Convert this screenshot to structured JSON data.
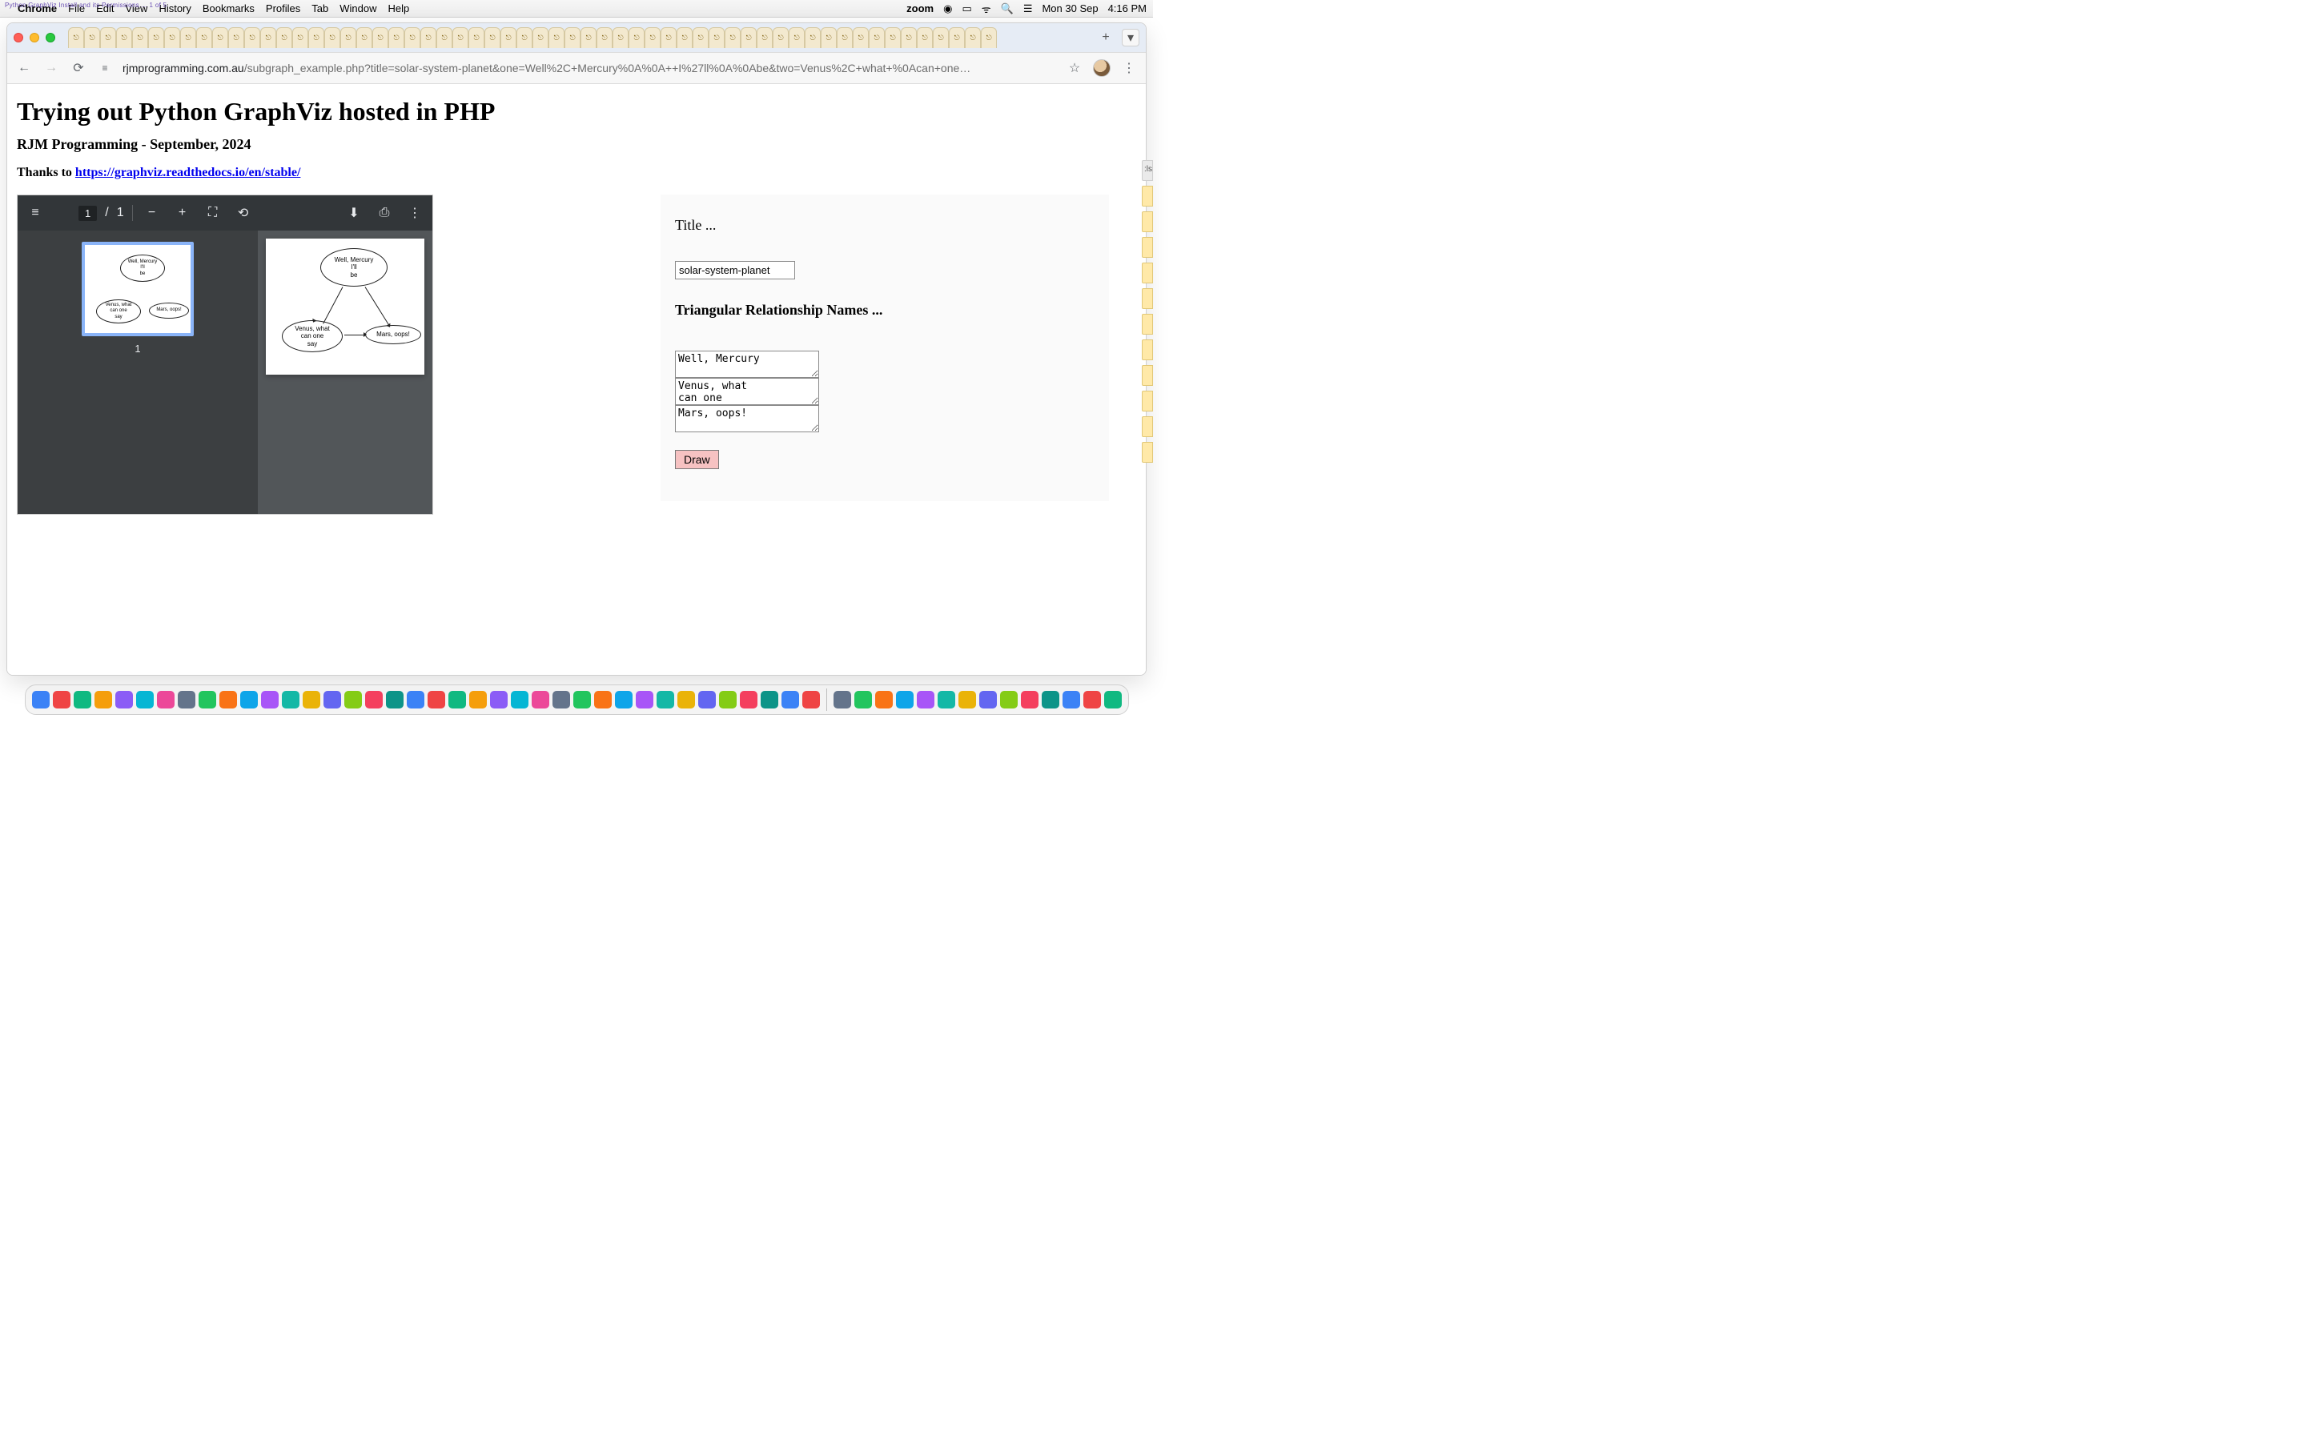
{
  "menubar": {
    "overlay": "Python GraphViz Install and its Permissions ... 1 of 5",
    "app": "Chrome",
    "items": [
      "File",
      "Edit",
      "View",
      "History",
      "Bookmarks",
      "Profiles",
      "Tab",
      "Window",
      "Help"
    ],
    "right": {
      "zoom": "zoom",
      "date": "Mon 30 Sep",
      "time": "4:16 PM"
    }
  },
  "browser": {
    "url_host": "rjmprogramming.com.au",
    "url_path": "/subgraph_example.php?title=solar-system-planet&one=Well%2C+Mercury%0A%0A++I%27ll%0A%0Abe&two=Venus%2C+what+%0Acan+one…",
    "tab_count": 58,
    "newtab_label": "+",
    "tabmenu_label": "▾"
  },
  "page": {
    "h1": "Trying out Python GraphViz hosted in PHP",
    "sub": "RJM Programming - September, 2024",
    "thanks_prefix": "Thanks to ",
    "thanks_link": "https://graphviz.readthedocs.io/en/stable/"
  },
  "pdf": {
    "page_current": "1",
    "page_sep": "/",
    "page_total": "1",
    "thumb_number": "1",
    "nodes": {
      "top": "Well, Mercury",
      "top_l2": "I'll",
      "top_l3": "be",
      "left": "Venus, what",
      "left_l2": "can one",
      "left_l3": "say",
      "right": "Mars, oops!"
    }
  },
  "form": {
    "title_label": "Title ...",
    "title_value": "solar-system-planet",
    "rel_label": "Triangular Relationship Names ...",
    "ta1": "Well, Mercury",
    "ta2": "Venus, what\ncan one",
    "ta3": "Mars, oops!",
    "draw": "Draw"
  },
  "peek": {
    "label": ":ls"
  },
  "dock": {
    "count_left": 38,
    "count_right": 14
  },
  "icons": {
    "apple": "",
    "back": "←",
    "forward": "→",
    "reload": "⟳",
    "site": "≡",
    "star": "☆",
    "kebab": "⋮",
    "menu": "≡",
    "zoom_out": "−",
    "zoom_in": "+",
    "fit": "⛶",
    "rotate": "⟲",
    "download": "⬇",
    "print": "⎙",
    "more": "⋮",
    "controlcenter": "⌁",
    "wifi": "⌔",
    "search": "⌕",
    "battery": "▭"
  },
  "colors": {
    "accent_pink": "#f6c2c2",
    "pdf_bg": "#323639",
    "pdf_body": "#525659",
    "thumb_border": "#8ab4f8"
  }
}
